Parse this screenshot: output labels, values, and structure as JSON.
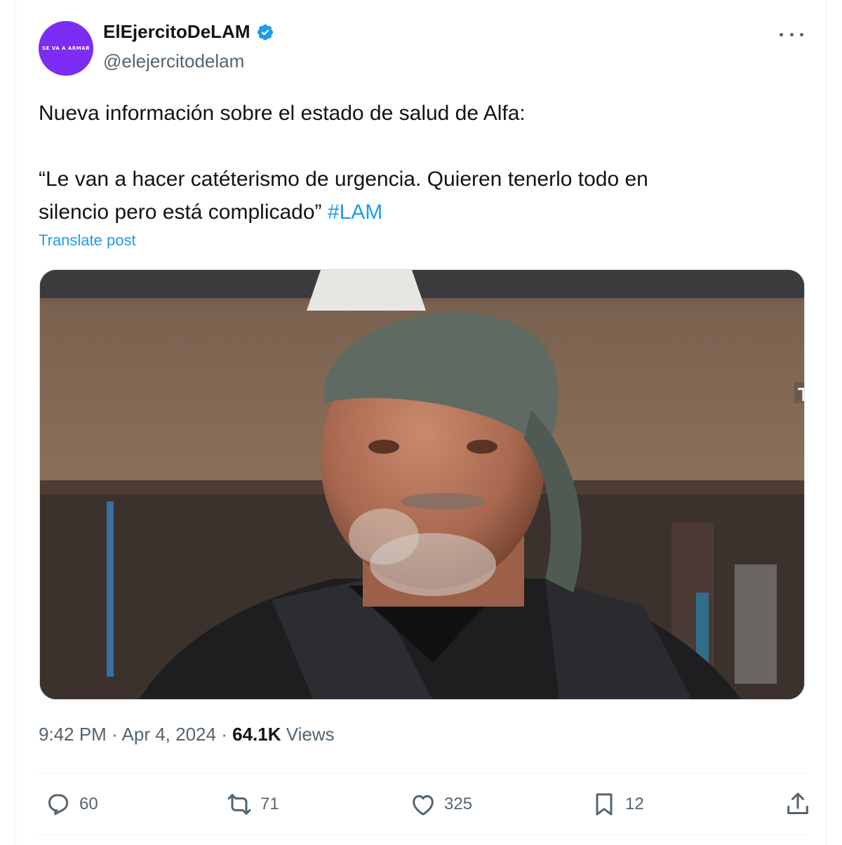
{
  "tweet": {
    "display_name": "ElEjercitoDeLAM",
    "handle": "@elejercitodelam",
    "avatar_text": "SE VA A ARMAR",
    "text_line1": "Nueva información sobre el estado de salud de Alfa:",
    "text_line2": "“Le van a hacer catéterismo de urgencia. Quieren tenerlo todo en",
    "text_line3": "silencio pero está complicado”",
    "hashtag": "#LAM",
    "translate_label": "Translate post",
    "time": "9:42 PM",
    "separator": "·",
    "date": "Apr 4, 2024",
    "views_count": "64.1K",
    "views_label": "Views",
    "media_overlay_letter": "T"
  },
  "actions": {
    "replies": "60",
    "reposts": "71",
    "likes": "325",
    "bookmarks": "12"
  },
  "colors": {
    "accent": "#1d9bf0",
    "secondary_text": "#536471",
    "avatar_bg": "#7b2cf5"
  },
  "icons": [
    "verified-badge-icon",
    "more-icon",
    "reply-icon",
    "repost-icon",
    "like-icon",
    "bookmark-icon",
    "share-icon"
  ]
}
